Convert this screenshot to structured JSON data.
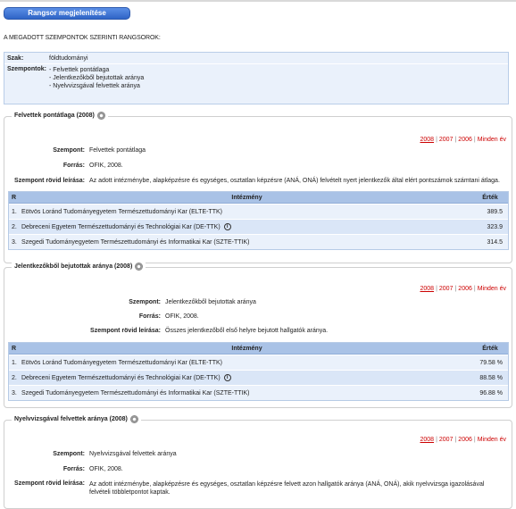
{
  "header": {
    "button_label": "Rangsor megjelenítése"
  },
  "intro": "A MEGADOTT SZEMPONTOK SZERINTI RANGSOROK:",
  "criteria": {
    "szak_label": "Szak:",
    "szak_value": "földtudományi",
    "szempontok_label": "Szempontok:",
    "szempontok_items": [
      "- Felvettek pontátlaga",
      "- Jelentkezőkből bejutottak aránya",
      "- Nyelvvizsgával felvettek aránya"
    ]
  },
  "labels": {
    "szempont": "Szempont:",
    "forras": "Forrás:",
    "rovid": "Szempont rövid leírása:",
    "col_r": "R",
    "col_intezmeny": "Intézmény",
    "col_ertek": "Érték"
  },
  "years": {
    "y2008": "2008",
    "y2007": "2007",
    "y2006": "2006",
    "all": "Minden év",
    "sep": "|"
  },
  "sections": [
    {
      "title": "Felvettek pontátlaga (2008)",
      "szempont": "Felvettek pontátlaga",
      "forras": "OFIK, 2008.",
      "rovid": "Az adott intézménybe, alapképzésre és egységes, osztatlan képzésre (ANÁ, ONÁ) felvételt nyert jelentkezők által elért pontszámok számtani átlaga.",
      "rows": [
        {
          "n": "1.",
          "name": "Eötvös Loránd Tudományegyetem Természettudományi Kar (ELTE-TTK)",
          "val": "389.5"
        },
        {
          "n": "2.",
          "name": "Debreceni Egyetem Természettudományi és Technológiai Kar (DE-TTK)",
          "val": "323.9"
        },
        {
          "n": "3.",
          "name": "Szegedi Tudományegyetem Természettudományi és Informatikai Kar (SZTE-TTIK)",
          "val": "314.5"
        }
      ]
    },
    {
      "title": "Jelentkezőkből bejutottak aránya (2008)",
      "szempont": "Jelentkezőkből bejutottak aránya",
      "forras": "OFIK, 2008.",
      "rovid": "Összes jelentkezőből első helyre bejutott hallgatók aránya.",
      "rows": [
        {
          "n": "1.",
          "name": "Eötvös Loránd Tudományegyetem Természettudományi Kar (ELTE-TTK)",
          "val": "79.58 %"
        },
        {
          "n": "2.",
          "name": "Debreceni Egyetem Természettudományi és Technológiai Kar (DE-TTK)",
          "val": "88.58 %"
        },
        {
          "n": "3.",
          "name": "Szegedi Tudományegyetem Természettudományi és Informatikai Kar (SZTE-TTIK)",
          "val": "96.88 %"
        }
      ]
    },
    {
      "title": "Nyelvvizsgával felvettek aránya (2008)",
      "szempont": "Nyelvvizsgával felvettek aránya",
      "forras": "OFIK, 2008.",
      "rovid": "Az adott intézménybe, alapképzésre és egységes, osztatlan képzésre felvett azon hallgatók aránya (ANÁ, ONÁ), akik nyelvvizsga igazolásával felvételi többletpontot kaptak."
    }
  ]
}
